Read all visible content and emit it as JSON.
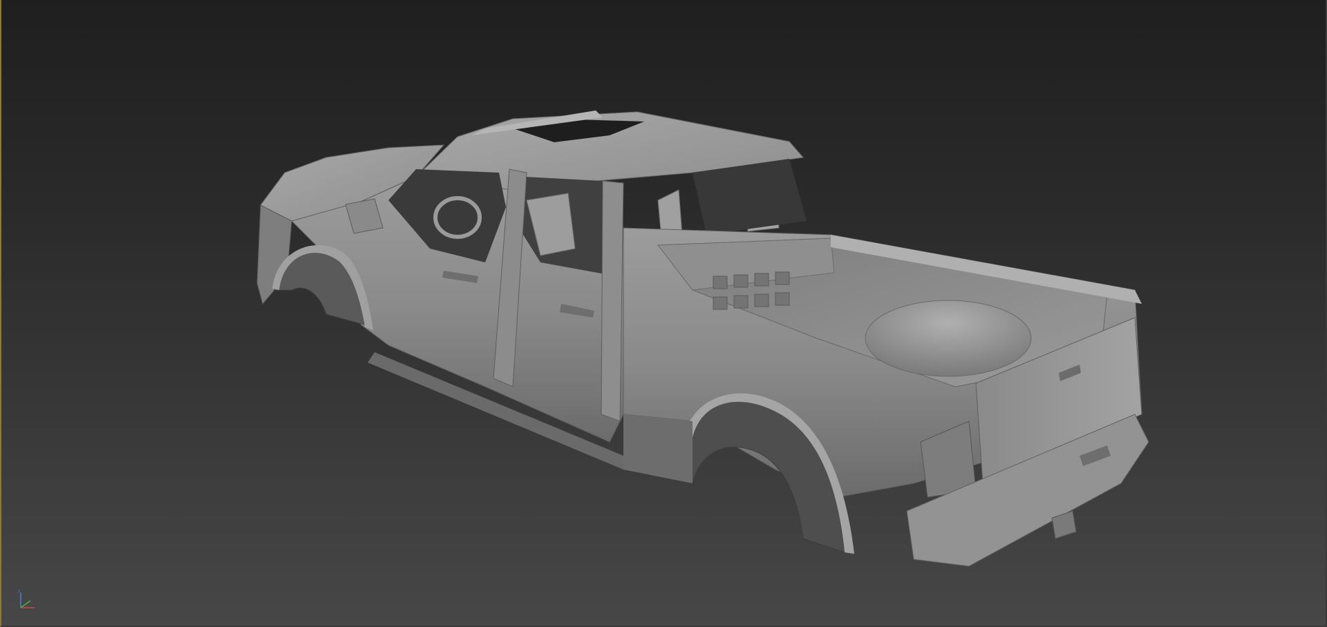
{
  "viewport": {
    "name": "perspective-viewport",
    "background_top": "#1f1f1f",
    "background_bottom": "#474747",
    "active_border_color": "#8f7a35",
    "shading": "clay-grey",
    "model": "pickup-truck-body-shell"
  },
  "axis_gizmo": {
    "icon": "xyz-axis-tripod-icon",
    "x_color": "#c94a3a",
    "y_color": "#4fb04a",
    "z_color": "#4a7fd6",
    "z_label": "z"
  }
}
